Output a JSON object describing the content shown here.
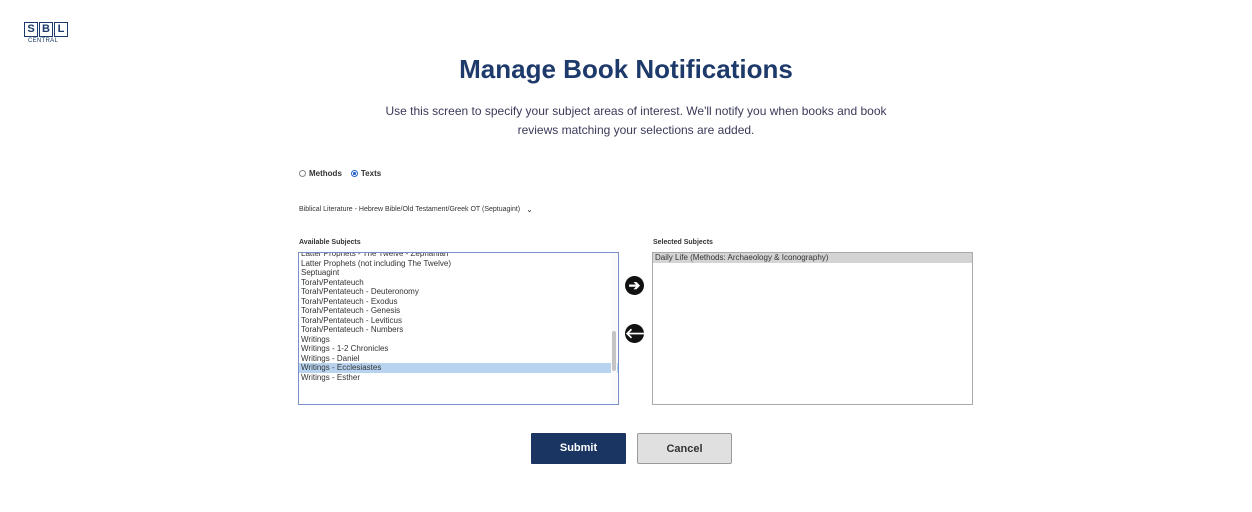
{
  "logo": {
    "letters": [
      "S",
      "B",
      "L"
    ],
    "subtitle": "CENTRAL"
  },
  "header": {
    "title": "Manage Book Notifications",
    "intro": "Use this screen to specify your subject areas of interest. We'll notify you when books and book reviews matching your selections are added."
  },
  "subject_type": {
    "options": [
      {
        "label": "Methods",
        "checked": false
      },
      {
        "label": "Texts",
        "checked": true
      }
    ]
  },
  "category": {
    "selected": "Biblical Literature - Hebrew Bible/Old Testament/Greek OT (Septuagint)"
  },
  "available": {
    "label": "Available Subjects",
    "items": [
      "Latter Prophets - The Twelve - Zephaniah",
      "Latter Prophets (not including The Twelve)",
      "Septuagint",
      "Torah/Pentateuch",
      "Torah/Pentateuch - Deuteronomy",
      "Torah/Pentateuch - Exodus",
      "Torah/Pentateuch - Genesis",
      "Torah/Pentateuch - Leviticus",
      "Torah/Pentateuch - Numbers",
      "Writings",
      "Writings - 1-2 Chronicles",
      "Writings - Daniel",
      "Writings - Ecclesiastes",
      "Writings - Esther"
    ],
    "highlighted": "Writings - Ecclesiastes"
  },
  "selected": {
    "label": "Selected Subjects",
    "items": [
      "Daily Life (Methods: Archaeology & Iconography)"
    ]
  },
  "actions": {
    "add": "➔",
    "remove": "🡐",
    "submit": "Submit",
    "cancel": "Cancel"
  }
}
